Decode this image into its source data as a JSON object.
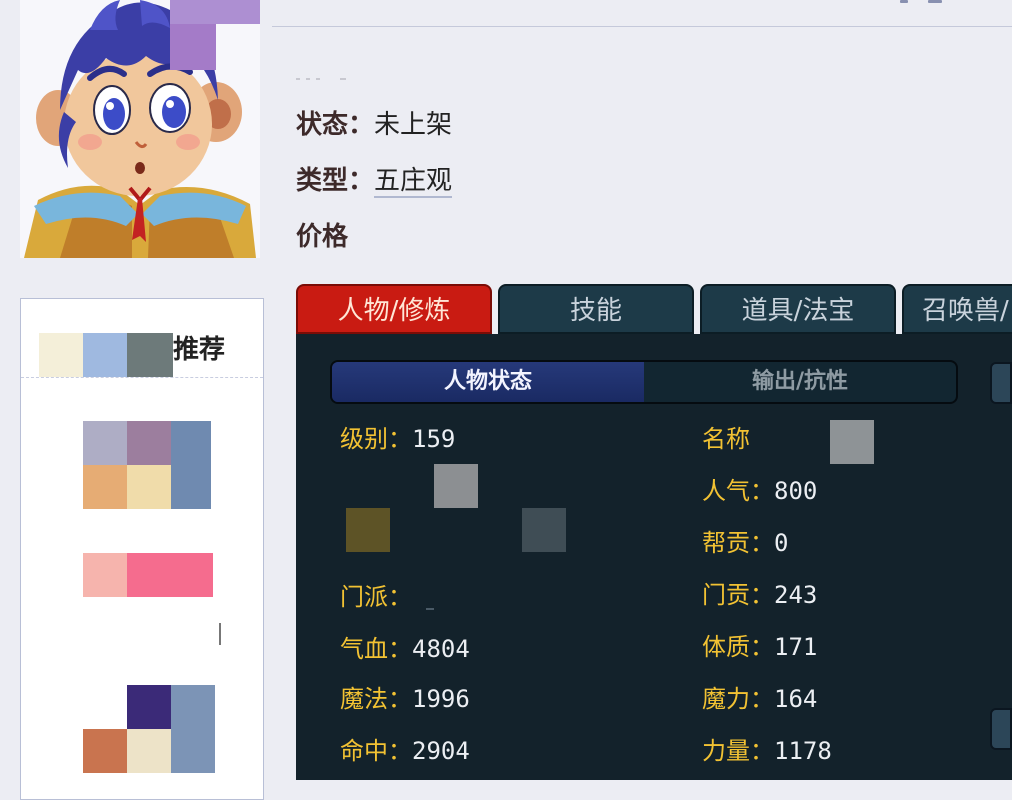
{
  "character": {
    "status_label": "状态：",
    "status_value": "未上架",
    "type_label": "类型：",
    "type_value": "五庄观",
    "price_label": "价格"
  },
  "sidebar": {
    "title": "推荐"
  },
  "tabs": [
    {
      "label": "人物/修炼",
      "active": true
    },
    {
      "label": "技能",
      "active": false
    },
    {
      "label": "道具/法宝",
      "active": false
    },
    {
      "label": "召唤兽/",
      "active": false
    }
  ],
  "subtabs": [
    {
      "label": "人物状态",
      "active": true
    },
    {
      "label": "输出/抗性",
      "active": false
    }
  ],
  "stats_left": [
    {
      "label": "级别：",
      "value": "159"
    },
    {
      "label": "门派：",
      "value": ""
    },
    {
      "label": "气血：",
      "value": "4804"
    },
    {
      "label": "魔法：",
      "value": "1996"
    },
    {
      "label": "命中：",
      "value": "2904"
    }
  ],
  "stats_right": [
    {
      "label": "名称",
      "value": ""
    },
    {
      "label": "人气：",
      "value": "800"
    },
    {
      "label": "帮贡：",
      "value": "0"
    },
    {
      "label": "门贡：",
      "value": "243"
    },
    {
      "label": "体质：",
      "value": "171"
    },
    {
      "label": "魔力：",
      "value": "164"
    },
    {
      "label": "力量：",
      "value": "1178"
    }
  ],
  "colors": {
    "active_tab": "#c91b12",
    "tab": "#1d3a48",
    "panel": "#13222b",
    "stat_label": "#f2c233",
    "stat_value": "#eceff3"
  }
}
